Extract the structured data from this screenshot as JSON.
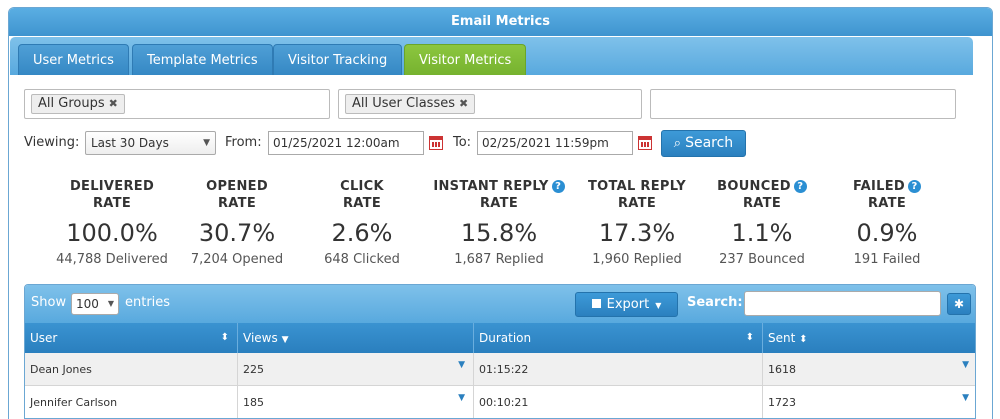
{
  "window": {
    "title": "Email Metrics"
  },
  "tabs": [
    {
      "label": "User Metrics",
      "active": false
    },
    {
      "label": "Template Metrics",
      "active": false
    },
    {
      "label": "Visitor Tracking",
      "active": false
    },
    {
      "label": "Visitor Metrics",
      "active": true
    }
  ],
  "filters": {
    "groups_tag": "All Groups",
    "user_classes_tag": "All User Classes",
    "remove_glyph": "✖",
    "third_value": ""
  },
  "date_range": {
    "viewing_label": "Viewing:",
    "viewing_value": "Last 30 Days",
    "from_label": "From:",
    "from_value": "01/25/2021 12:00am",
    "to_label": "To:",
    "to_value": "02/25/2021 11:59pm",
    "search_label": "Search",
    "search_icon": "⌕"
  },
  "metrics": [
    {
      "title_line1": "DELIVERED",
      "title_line2": "RATE",
      "value": "100.0%",
      "sub": "44,788 Delivered",
      "help": false
    },
    {
      "title_line1": "OPENED",
      "title_line2": "RATE",
      "value": "30.7%",
      "sub": "7,204 Opened",
      "help": false
    },
    {
      "title_line1": "CLICK",
      "title_line2": "RATE",
      "value": "2.6%",
      "sub": "648 Clicked",
      "help": false
    },
    {
      "title_line1": "INSTANT REPLY",
      "title_line2": "RATE",
      "value": "15.8%",
      "sub": "1,687 Replied",
      "help": true
    },
    {
      "title_line1": "TOTAL REPLY",
      "title_line2": "RATE",
      "value": "17.3%",
      "sub": "1,960 Replied",
      "help": false
    },
    {
      "title_line1": "BOUNCED",
      "title_line2": "RATE",
      "value": "1.1%",
      "sub": "237 Bounced",
      "help": true
    },
    {
      "title_line1": "FAILED",
      "title_line2": "RATE",
      "value": "0.9%",
      "sub": "191 Failed",
      "help": true
    }
  ],
  "help_glyph": "?",
  "table": {
    "show_label": "Show",
    "entries_value": "100",
    "entries_label": "entries",
    "export_label": "Export",
    "search_label": "Search:",
    "search_value": "",
    "settings_glyph": "✱",
    "columns": [
      {
        "label": "User",
        "sort": "⬍"
      },
      {
        "label": "Views",
        "sort": "▼"
      },
      {
        "label": "Duration",
        "sort": "⬍"
      },
      {
        "label": "Sent",
        "sort": "⬍"
      }
    ],
    "rows": [
      {
        "user": "Dean Jones",
        "views": "225",
        "duration": "01:15:22",
        "sent": "1618"
      },
      {
        "user": "Jennifer Carlson",
        "views": "185",
        "duration": "00:10:21",
        "sent": "1723"
      }
    ],
    "row_dropdown_glyph": "▼"
  },
  "colors": {
    "header_blue": "#3f94cf",
    "active_tab_green": "#8cc63f",
    "help_blue": "#2b8fd3",
    "calendar_red": "#cc3333"
  }
}
